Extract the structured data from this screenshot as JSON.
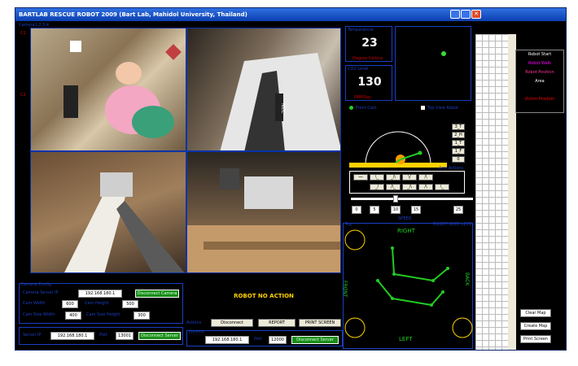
{
  "window": {
    "title": "BARTLAB RESCUE ROBOT 2009 (Bart Lab, Mahidol University, Thailand)"
  },
  "camera": {
    "label_top_left": "Camera1,2,3,4"
  },
  "sensors": {
    "temp_label": "Temperature",
    "temp_value": "23",
    "temp_unit": "Degree Celsius",
    "co2_label": "CO2 Level",
    "co2_value": "130",
    "co2_unit": "PPM/Sec"
  },
  "view_options": {
    "front_cam": "Front Cam",
    "top_view": "Top View Robot"
  },
  "arm_levels": [
    "3_T",
    "2_H",
    "1_T",
    "1_F",
    "0"
  ],
  "arm_actions_label": "Arm Actions",
  "speed": {
    "ticks": [
      "0",
      "5",
      "10",
      "15",
      "25"
    ],
    "label": "SPEED"
  },
  "robot_body": {
    "label": "ROBOT BODY LEVEL",
    "right": "RIGHT",
    "left": "LEFT",
    "front": "FRONT",
    "back": "BACK",
    "top_label": "Top"
  },
  "status": {
    "message": "ROBOT NO ACTION"
  },
  "connection": {
    "panel_label": "Camera Config",
    "camera_server_label": "Camera Server IP",
    "camera_server_ip": "192.168.180.1",
    "connect_camera_btn": "Disconnect Camera",
    "width_label": "Cam Width",
    "width_value": "600",
    "height_label": "Cam Height",
    "height_value": "500",
    "cam_width2_label": "Cam Size Width",
    "cam_width2_value": "400",
    "cam_height2_label": "Cam Size Height",
    "cam_height2_value": "300"
  },
  "server": {
    "label": "Server IP",
    "ip": "192.168.180.1",
    "port": "13001",
    "btn": "Disconnect Server",
    "joy_label": "Joystick",
    "ip2": "192.168.180.1",
    "port2": "12000",
    "btn2": "Disconnect Server",
    "port_label": "Port"
  },
  "actions": {
    "label": "Actions",
    "disconnect": "Disconnect",
    "report": "REPORT",
    "print_screen": "PRINT SCREEN"
  },
  "map_legend": {
    "items": [
      {
        "label": "Robot Start",
        "color": "#ffffff"
      },
      {
        "label": "Robot Walk",
        "color": "#ff00ff"
      },
      {
        "label": "Robot Position",
        "color": "#ff3399"
      },
      {
        "label": "Area",
        "color": "#ffffff"
      },
      {
        "label": "",
        "color": "#0000ff"
      },
      {
        "label": "Victim Position",
        "color": "#ff0000"
      }
    ]
  },
  "map_buttons": {
    "clear": "Clear Map",
    "create": "Create Map",
    "print": "Print Screen"
  },
  "colors": {
    "accent_blue": "#1a3fc4",
    "green": "#22cc22",
    "yellow": "#ffd200"
  }
}
